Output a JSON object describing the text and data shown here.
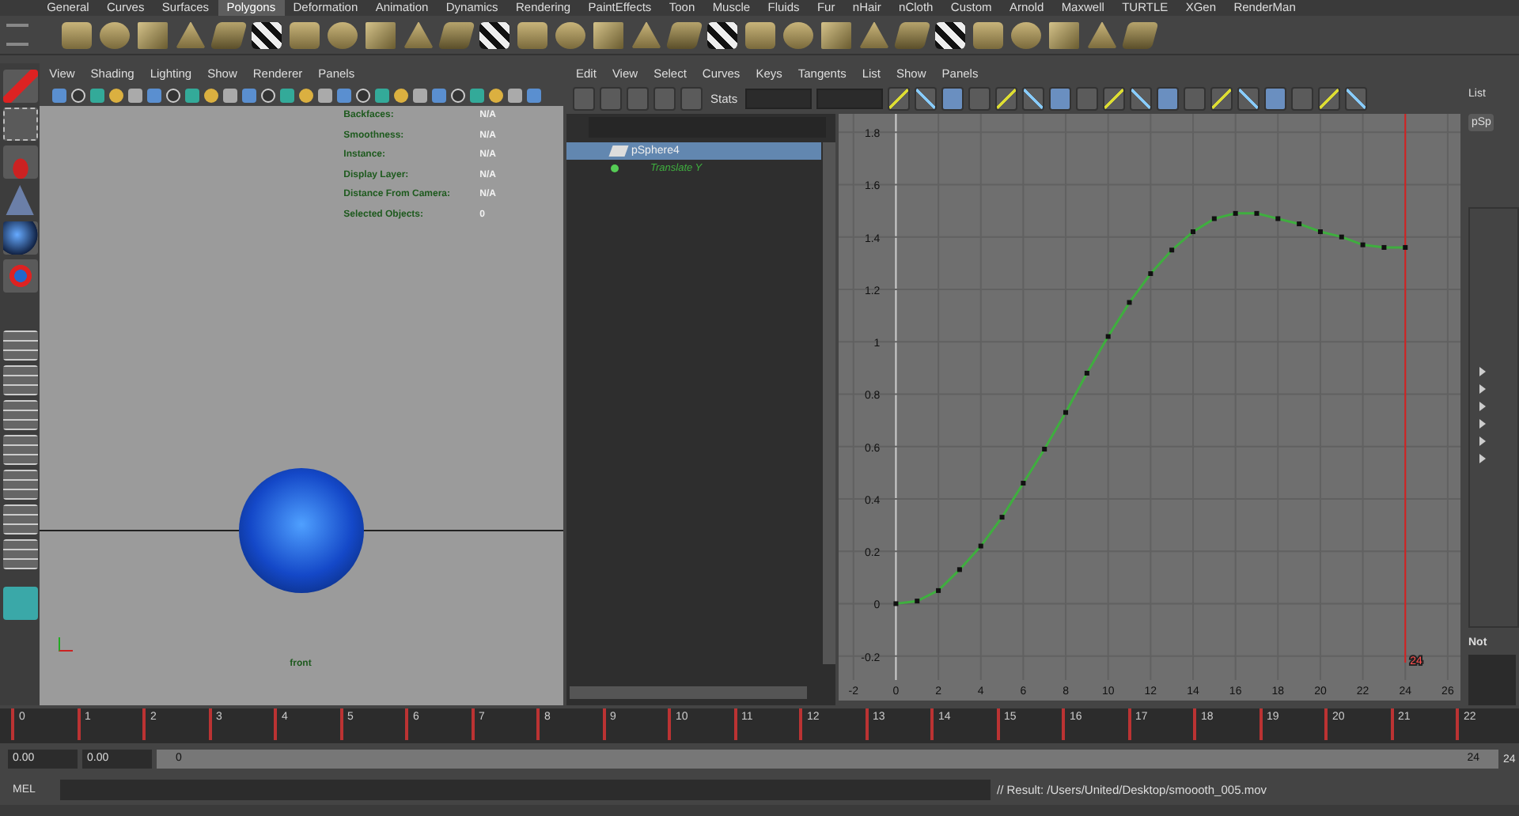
{
  "shelf": {
    "tabs": [
      {
        "label": "General",
        "selected": false
      },
      {
        "label": "Curves",
        "selected": false
      },
      {
        "label": "Surfaces",
        "selected": false
      },
      {
        "label": "Polygons",
        "selected": true
      },
      {
        "label": "Deformation",
        "selected": false
      },
      {
        "label": "Animation",
        "selected": false
      },
      {
        "label": "Dynamics",
        "selected": false
      },
      {
        "label": "Rendering",
        "selected": false
      },
      {
        "label": "PaintEffects",
        "selected": false
      },
      {
        "label": "Toon",
        "selected": false
      },
      {
        "label": "Muscle",
        "selected": false
      },
      {
        "label": "Fluids",
        "selected": false
      },
      {
        "label": "Fur",
        "selected": false
      },
      {
        "label": "nHair",
        "selected": false
      },
      {
        "label": "nCloth",
        "selected": false
      },
      {
        "label": "Custom",
        "selected": false
      },
      {
        "label": "Arnold",
        "selected": false
      },
      {
        "label": "Maxwell",
        "selected": false
      },
      {
        "label": "TURTLE",
        "selected": false
      },
      {
        "label": "XGen",
        "selected": false
      },
      {
        "label": "RenderMan",
        "selected": false
      }
    ]
  },
  "viewport": {
    "menu": [
      "View",
      "Shading",
      "Lighting",
      "Show",
      "Renderer",
      "Panels"
    ],
    "hud": [
      {
        "label": "Backfaces:",
        "value": "N/A"
      },
      {
        "label": "Smoothness:",
        "value": "N/A"
      },
      {
        "label": "Instance:",
        "value": "N/A"
      },
      {
        "label": "Display Layer:",
        "value": "N/A"
      },
      {
        "label": "Distance From Camera:",
        "value": "N/A"
      },
      {
        "label": "Selected Objects:",
        "value": "0"
      }
    ],
    "camera_label": "front"
  },
  "graph_editor": {
    "menu": [
      "Edit",
      "View",
      "Select",
      "Curves",
      "Keys",
      "Tangents",
      "List",
      "Show",
      "Panels"
    ],
    "stats_label": "Stats",
    "outliner": [
      {
        "label": "pSphere4",
        "selected": true
      }
    ],
    "chart_data": {
      "type": "line",
      "x": [
        0,
        1,
        2,
        3,
        4,
        5,
        6,
        7,
        8,
        9,
        10,
        11,
        12,
        13,
        14,
        15,
        16,
        17,
        18,
        19,
        20,
        21,
        22,
        23,
        24
      ],
      "series": [
        {
          "name": "Translate Y",
          "color": "#3fae3f",
          "marker": "square",
          "values": [
            0,
            0.01,
            0.05,
            0.13,
            0.22,
            0.33,
            0.46,
            0.59,
            0.73,
            0.88,
            1.02,
            1.15,
            1.26,
            1.35,
            1.42,
            1.47,
            1.49,
            1.49,
            1.47,
            1.45,
            1.42,
            1.4,
            1.37,
            1.36,
            1.36
          ]
        }
      ],
      "xlim": [
        -2.7,
        26.6
      ],
      "ylim": [
        -0.37,
        1.87
      ],
      "xticks": [
        -2,
        {
          "value": 0,
          "label": "0"
        },
        2,
        4,
        6,
        8,
        10,
        12,
        14,
        16,
        18,
        20,
        22,
        24,
        26
      ],
      "yticks": [
        -0.2,
        {
          "value": 0,
          "label": "0"
        },
        0.2,
        0.4,
        0.6,
        0.8,
        {
          "value": 1,
          "label": "1"
        },
        1.2,
        1.4,
        1.6,
        1.8
      ],
      "grid": true,
      "ref_lines": [
        {
          "axis": "x",
          "value": 24,
          "label": "24",
          "color": "#d62020"
        }
      ]
    }
  },
  "right_panel": {
    "title": "List",
    "button": "pSp",
    "notes": "Not"
  },
  "timeline": {
    "labels": [
      "0",
      "1",
      "2",
      "3",
      "4",
      "5",
      "6",
      "7",
      "8",
      "9",
      "10",
      "11",
      "12",
      "13",
      "14",
      "15",
      "16",
      "17",
      "18",
      "19",
      "20",
      "21",
      "22"
    ]
  },
  "range": {
    "level": 1,
    "start": "0.00",
    "playback_start": "0.00",
    "slider_start": "0",
    "slider_end": "24",
    "end": "24"
  },
  "command": {
    "label": "MEL",
    "result": "// Result: /Users/United/Desktop/smoooth_005.mov"
  }
}
